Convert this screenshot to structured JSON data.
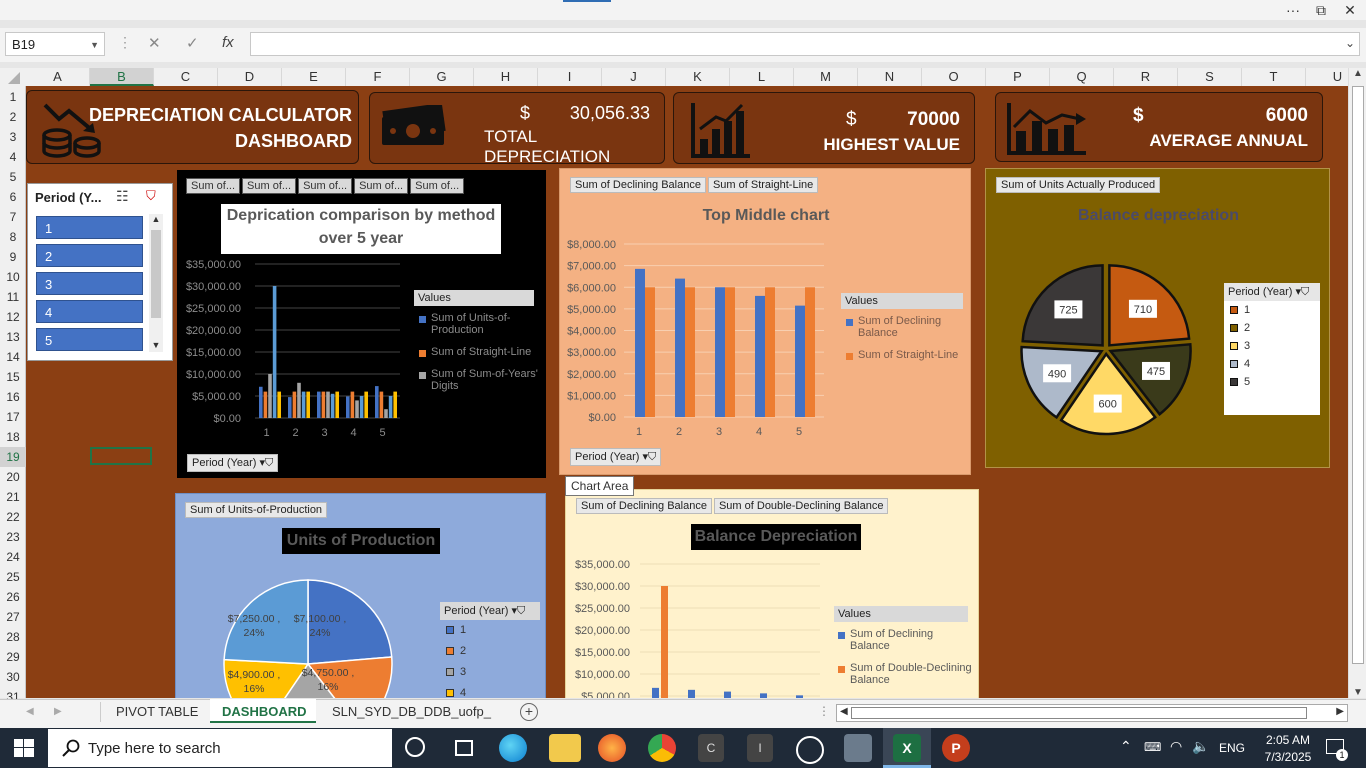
{
  "window": {
    "more": "···",
    "restore": "⧉",
    "close": "✕"
  },
  "formula_bar": {
    "cell_ref": "B19",
    "cancel": "✕",
    "enter": "✓",
    "fx": "fx"
  },
  "columns": [
    "A",
    "B",
    "C",
    "D",
    "E",
    "F",
    "G",
    "H",
    "I",
    "J",
    "K",
    "L",
    "M",
    "N",
    "O",
    "P",
    "Q",
    "R",
    "S",
    "T",
    "U"
  ],
  "rows": [
    "1",
    "2",
    "3",
    "4",
    "5",
    "6",
    "7",
    "8",
    "9",
    "10",
    "11",
    "12",
    "13",
    "14",
    "15",
    "16",
    "17",
    "18",
    "19",
    "20",
    "21",
    "22",
    "23",
    "24",
    "25",
    "26",
    "27",
    "28",
    "29",
    "30",
    "31"
  ],
  "kpis": {
    "title_line1": "DEPRECIATION CALCULATOR",
    "title_line2": "DASHBOARD",
    "total_currency": "$",
    "total_value": "30,056.33",
    "total_label": "TOTAL DEPRECIATION",
    "highest_currency": "$",
    "highest_value": "70000",
    "highest_label": "HIGHEST VALUE",
    "average_currency": "$",
    "average_value": "6000",
    "average_label": "AVERAGE  ANNUAL"
  },
  "slicer": {
    "title": "Period (Y...",
    "items": [
      "1",
      "2",
      "3",
      "4",
      "5"
    ]
  },
  "colors": {
    "blue": "#4472c4",
    "orange": "#ed7d31",
    "gray": "#a5a5a5",
    "yellow": "#ffc000",
    "sheet": "#8b3f13"
  },
  "chart_data": [
    {
      "type": "bar",
      "title": "Deprication comparison by method over 5 year",
      "field_buttons": [
        "Sum of...",
        "Sum of...",
        "Sum of...",
        "Sum of...",
        "Sum of..."
      ],
      "filter_button": "Period (Year)",
      "legend_title": "Values",
      "categories": [
        "1",
        "2",
        "3",
        "4",
        "5"
      ],
      "y_ticks": [
        "$35,000.00",
        "$30,000.00",
        "$25,000.00",
        "$20,000.00",
        "$15,000.00",
        "$10,000.00",
        "$5,000.00",
        "$0.00"
      ],
      "ylim": [
        0,
        35000
      ],
      "series": [
        {
          "name": "Sum of Units-of-Production",
          "values": [
            7100,
            4750,
            6000,
            4900,
            7250
          ]
        },
        {
          "name": "Sum of Straight-Line",
          "values": [
            6000,
            6000,
            6000,
            6000,
            6000
          ]
        },
        {
          "name": "Sum of Sum-of-Years' Digits",
          "values": [
            10000,
            8000,
            6000,
            4000,
            2000
          ]
        },
        {
          "name": "",
          "values": [
            30000,
            6000,
            5500,
            5000,
            5000
          ]
        },
        {
          "name": "",
          "values": [
            6000,
            6000,
            6000,
            6000,
            6000
          ]
        }
      ]
    },
    {
      "type": "bar",
      "title": "Top Middle chart",
      "field_buttons": [
        "Sum of Declining Balance",
        "Sum of Straight-Line"
      ],
      "filter_button": "Period (Year)",
      "legend_title": "Values",
      "categories": [
        "1",
        "2",
        "3",
        "4",
        "5"
      ],
      "y_ticks": [
        "$8,000.00",
        "$7,000.00",
        "$6,000.00",
        "$5,000.00",
        "$4,000.00",
        "$3,000.00",
        "$2,000.00",
        "$1,000.00",
        "$0.00"
      ],
      "ylim": [
        0,
        8000
      ],
      "series": [
        {
          "name": "Sum of Declining Balance",
          "values": [
            6850,
            6400,
            6000,
            5600,
            5150
          ]
        },
        {
          "name": "Sum of Straight-Line",
          "values": [
            6000,
            6000,
            6000,
            6000,
            6000
          ]
        }
      ]
    },
    {
      "type": "pie",
      "title": "Balance depreciation",
      "field_buttons": [
        "Sum of Units Actually Produced"
      ],
      "legend_title": "Period (Year)",
      "categories": [
        "1",
        "2",
        "3",
        "4",
        "5"
      ],
      "values": [
        710,
        475,
        600,
        490,
        725
      ],
      "data_labels": [
        "710",
        "475",
        "600",
        "490",
        "725"
      ]
    },
    {
      "type": "pie",
      "title": "Units of Production",
      "field_buttons": [
        "Sum of Units-of-Production"
      ],
      "legend_title": "Period (Year)",
      "categories": [
        "1",
        "2",
        "3",
        "4"
      ],
      "values": [
        7100,
        4750,
        6000,
        4900,
        7250
      ],
      "data_labels": [
        "$7,100.00 , 24%",
        "$4,750.00 , 16%",
        "",
        "$4,900.00 , 16%",
        "$7,250.00 , 24%"
      ]
    },
    {
      "type": "bar",
      "title": "Balance Depreciation",
      "field_buttons": [
        "Sum of Declining Balance",
        "Sum of Double-Declining Balance"
      ],
      "legend_title": "Values",
      "y_ticks": [
        "$35,000.00",
        "$30,000.00",
        "$25,000.00",
        "$20,000.00",
        "$15,000.00",
        "$10,000.00",
        "$5,000.00"
      ],
      "ylim": [
        0,
        35000
      ],
      "series": [
        {
          "name": "Sum of Declining Balance",
          "values": [
            6850,
            6400,
            6000,
            5600,
            5150
          ]
        },
        {
          "name": "Sum of Double-Declining Balance",
          "values": [
            30000
          ]
        }
      ]
    }
  ],
  "tooltip": "Chart Area",
  "sheet_tabs": [
    "PIVOT  TABLE",
    "DASHBOARD",
    "SLN_SYD_DB_DDB_uofp_"
  ],
  "active_tab": "DASHBOARD",
  "taskbar": {
    "search_placeholder": "Type here to search",
    "time": "2:05 AM",
    "date": "7/3/2025",
    "lang": "ENG",
    "notification_count": "1"
  }
}
